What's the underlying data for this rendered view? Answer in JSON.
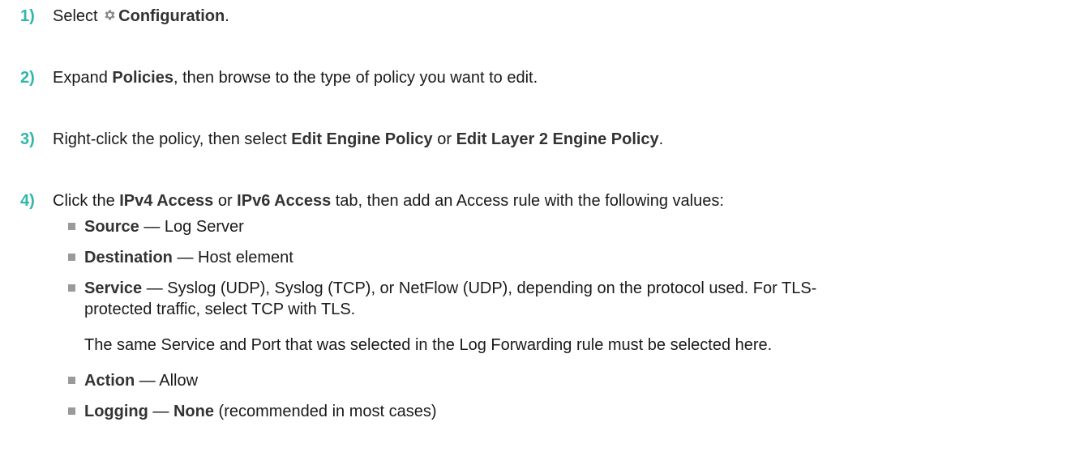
{
  "steps": [
    {
      "number": "1)",
      "text_before": "Select ",
      "icon": "gear-icon",
      "bold": "Configuration",
      "text_after": "."
    },
    {
      "number": "2)",
      "text_before": "Expand ",
      "bold": "Policies",
      "text_after": ", then browse to the type of policy you want to edit."
    },
    {
      "number": "3)",
      "text_before": "Right-click the policy, then select ",
      "bold1": "Edit Engine Policy",
      "mid": " or ",
      "bold2": "Edit Layer 2 Engine Policy",
      "text_after": "."
    },
    {
      "number": "4)",
      "text_before": "Click the ",
      "bold1": "IPv4 Access",
      "mid": " or ",
      "bold2": "IPv6 Access",
      "text_after": " tab, then add an Access rule with the following values:"
    }
  ],
  "rule_values": [
    {
      "label": "Source",
      "value": " — Log Server"
    },
    {
      "label": "Destination",
      "value": " — Host element"
    },
    {
      "label": "Service",
      "value_line1": " — Syslog (UDP), Syslog (TCP), or NetFlow (UDP), depending on the protocol used. For TLS-",
      "value_line2": "protected traffic, select TCP with TLS."
    },
    {
      "label": "Action",
      "value": " — Allow"
    },
    {
      "label": "Logging",
      "value_before": " — ",
      "value_bold": "None",
      "value_after": " (recommended in most cases)"
    }
  ],
  "service_note": "The same Service and Port that was selected in the Log Forwarding rule must be selected here.",
  "colors": {
    "step_number": "#2fb7a8",
    "bullet": "#9a9a9a",
    "text": "#1a1a1a"
  }
}
